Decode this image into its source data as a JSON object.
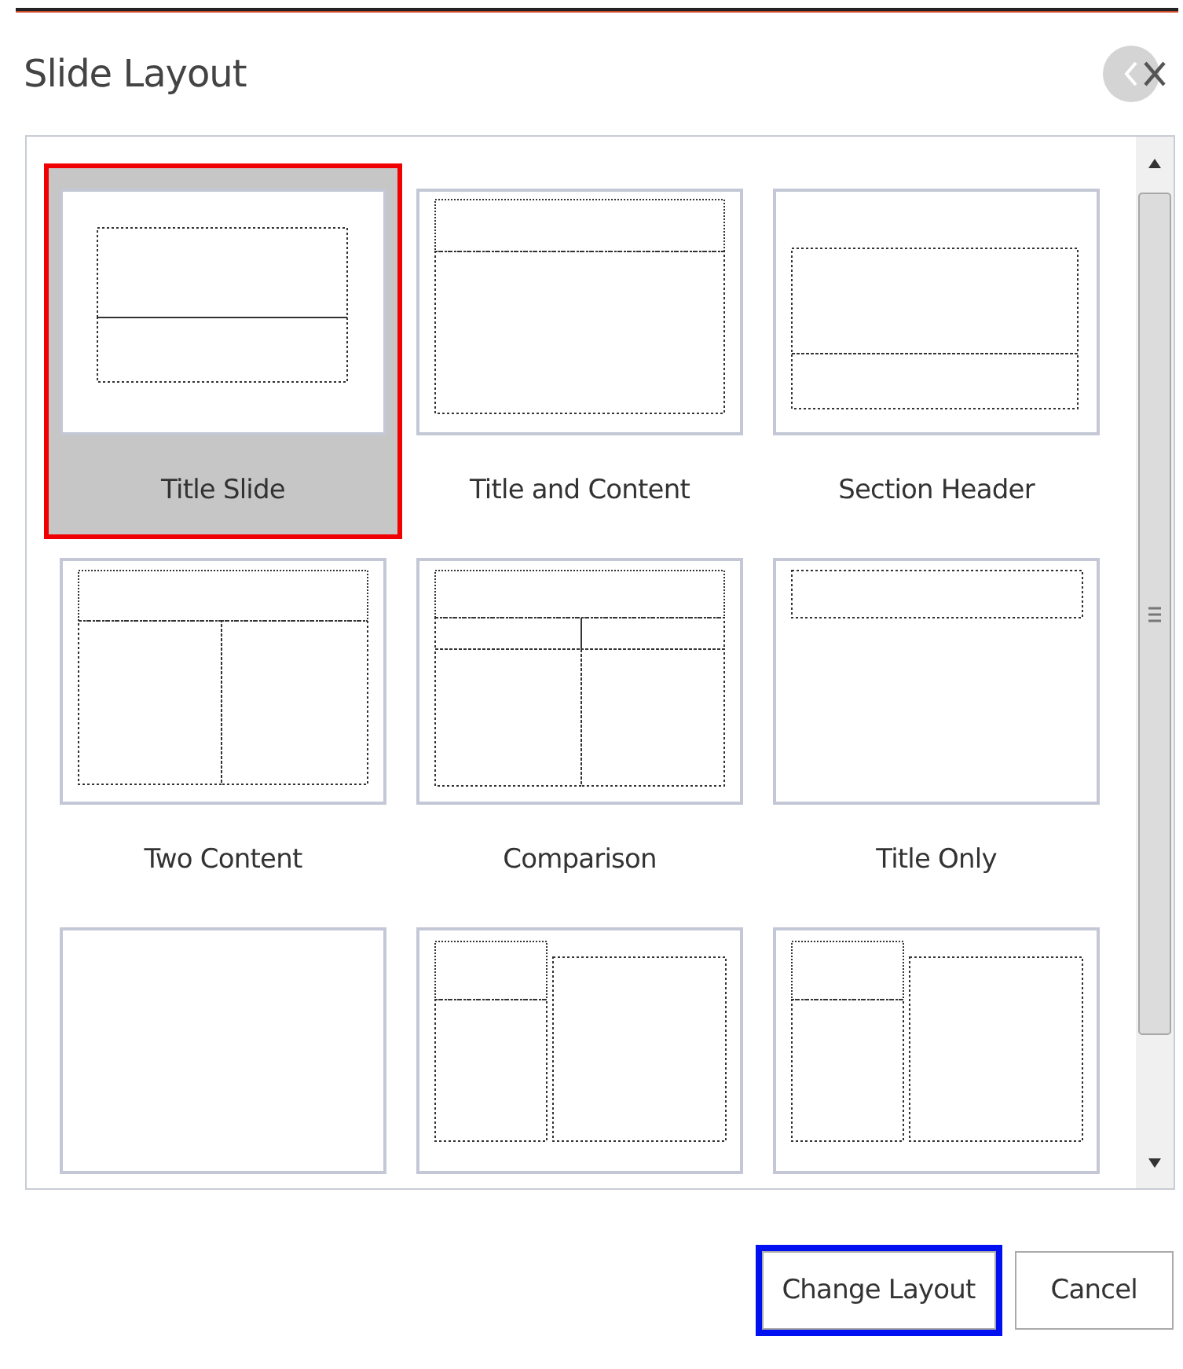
{
  "dialog": {
    "title": "Slide Layout"
  },
  "layouts": [
    {
      "label": "Title Slide",
      "kind": "title",
      "selected": true
    },
    {
      "label": "Title and Content",
      "kind": "title-content",
      "selected": false
    },
    {
      "label": "Section Header",
      "kind": "section",
      "selected": false
    },
    {
      "label": "Two Content",
      "kind": "two-content",
      "selected": false
    },
    {
      "label": "Comparison",
      "kind": "comparison",
      "selected": false
    },
    {
      "label": "Title Only",
      "kind": "title-only",
      "selected": false
    },
    {
      "kind": "blank",
      "selected": false
    },
    {
      "kind": "content-caption",
      "selected": false
    },
    {
      "kind": "picture-caption",
      "selected": false
    }
  ],
  "buttons": [
    {
      "label": "Change Layout",
      "focused": true
    },
    {
      "label": "Cancel",
      "focused": false
    }
  ]
}
